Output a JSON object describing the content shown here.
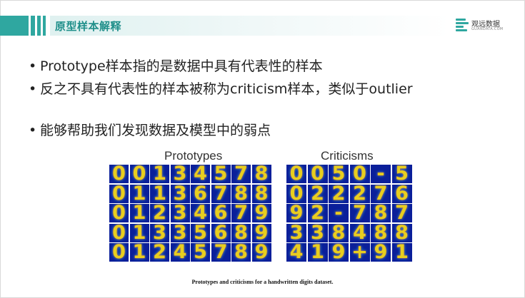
{
  "header": {
    "title": "原型样本解释",
    "accent_color": "#2fa7a0"
  },
  "logo": {
    "name": "观远数据",
    "sub": "GUANDATA.COM",
    "icon": "guandata-logo-icon"
  },
  "bullets": [
    "Prototype样本指的是数据中具有代表性的样本",
    "反之不具有代表性的样本被称为criticism样本，类似于outlier",
    "能够帮助我们发现数据及模型中的弱点"
  ],
  "figure": {
    "prototypes_title": "Prototypes",
    "criticisms_title": "Criticisms",
    "prototypes_rows": [
      [
        "0",
        "0",
        "1",
        "3",
        "4",
        "5",
        "7",
        "8"
      ],
      [
        "0",
        "1",
        "1",
        "3",
        "6",
        "7",
        "8",
        "8"
      ],
      [
        "0",
        "1",
        "2",
        "3",
        "4",
        "6",
        "7",
        "9"
      ],
      [
        "0",
        "1",
        "3",
        "3",
        "5",
        "6",
        "8",
        "9"
      ],
      [
        "0",
        "1",
        "2",
        "4",
        "5",
        "7",
        "8",
        "9"
      ]
    ],
    "criticisms_rows": [
      [
        "0",
        "0",
        "5",
        "0",
        "-",
        "5"
      ],
      [
        "0",
        "2",
        "2",
        "2",
        "7",
        "6"
      ],
      [
        "9",
        "2",
        "-",
        "7",
        "8",
        "7"
      ],
      [
        "3",
        "3",
        "8",
        "4",
        "8",
        "8"
      ],
      [
        "4",
        "1",
        "9",
        "+",
        "9",
        "1"
      ]
    ],
    "caption": "Prototypes and criticisms for a handwritten digits dataset."
  }
}
